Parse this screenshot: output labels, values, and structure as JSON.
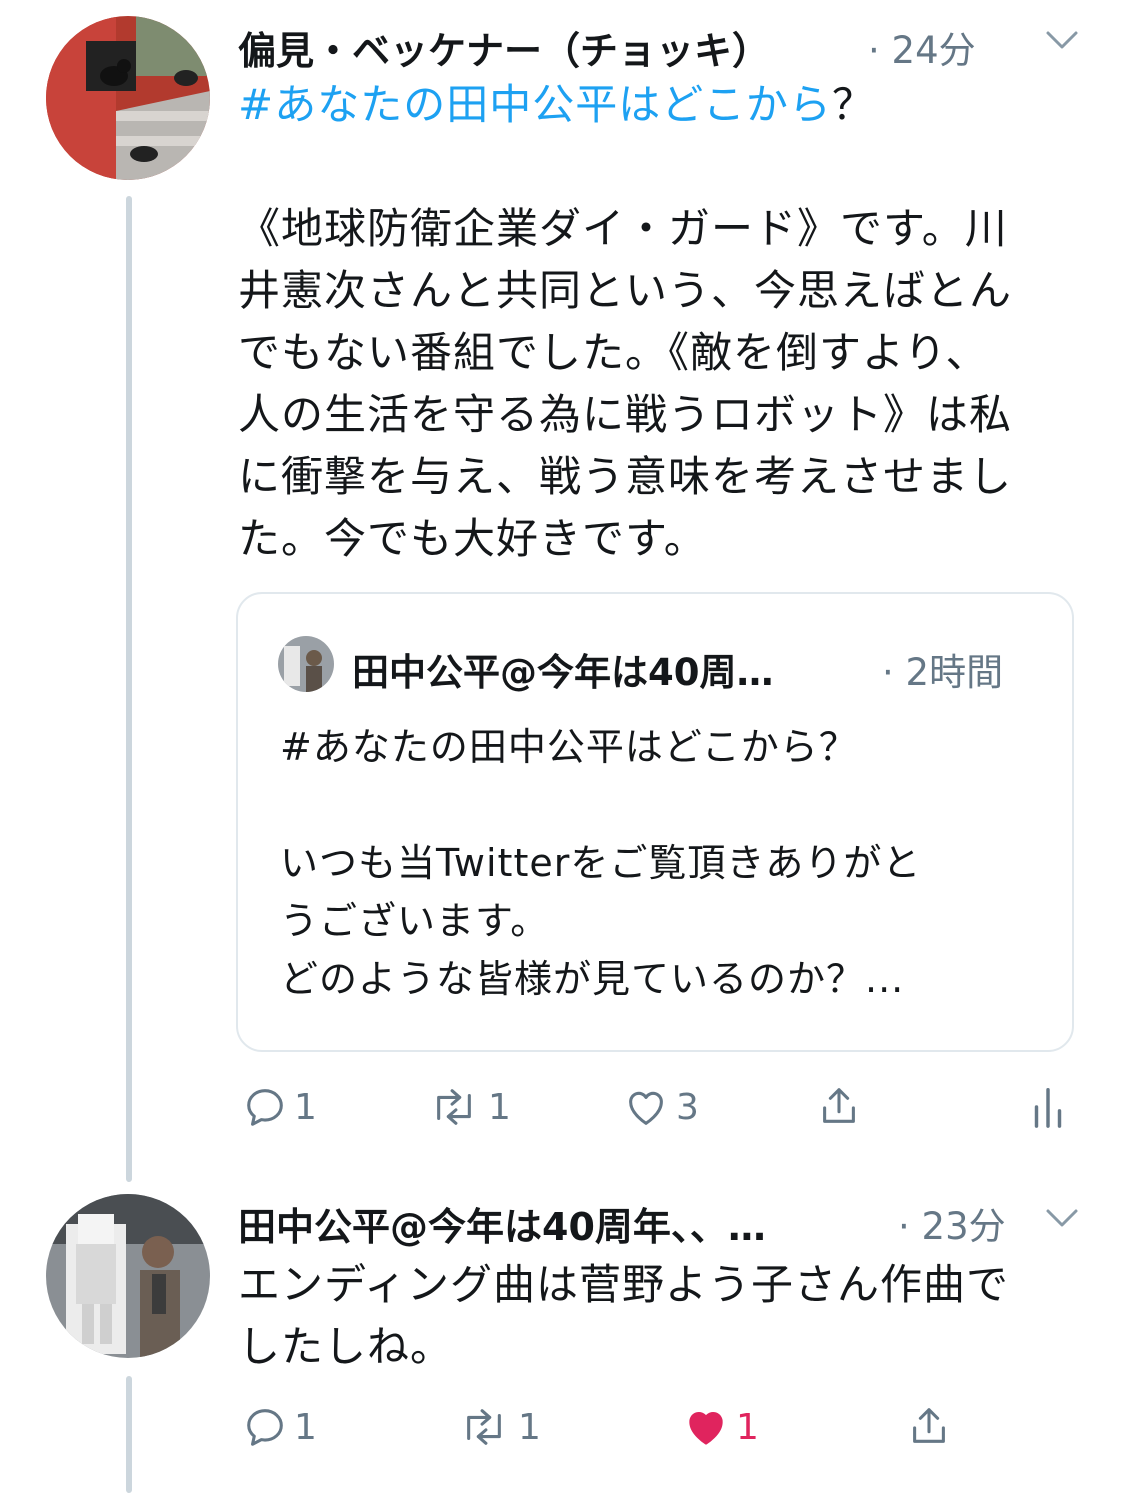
{
  "tweet1": {
    "author_name": "偏見・ベッケナー（チョッキ）",
    "time": "· 24分",
    "hashtag": "#あなたの田中公平はどこから",
    "hashtag_suffix": "？",
    "lines": [
      "《地球防衛企業ダイ・ガード》です。川",
      "井憲次さんと共同という、今思えばとん",
      "でもない番組でした。《敵を倒すより、",
      "人の生活を守る為に戦うロボット》は私",
      "に衝撃を与え、戦う意味を考えさせまし",
      "た。今でも大好きです。"
    ],
    "quote": {
      "author_name": "田中公平@今年は40周…",
      "time": "· 2時間",
      "lines": [
        "#あなたの田中公平はどこから？",
        "",
        "いつも当Twitterをご覧頂きありがと",
        "うございます。",
        "どのような皆様が見ているのか？..."
      ]
    },
    "actions": {
      "reply_count": "1",
      "retweet_count": "1",
      "like_count": "3"
    }
  },
  "tweet2": {
    "author_name": "田中公平@今年は40周年、、…",
    "time": "· 23分",
    "lines": [
      "エンディング曲は菅野よう子さん作曲で",
      "したしね。"
    ],
    "actions": {
      "reply_count": "1",
      "retweet_count": "1",
      "like_count": "1",
      "liked": true
    }
  },
  "colors": {
    "accent": "#1da1f2",
    "muted": "#657786",
    "like_active": "#e0245e",
    "border": "#e1e8ed",
    "thread_line": "#ccd6dd"
  },
  "icons": [
    "chevron-down-icon",
    "reply-icon",
    "retweet-icon",
    "like-icon",
    "share-icon",
    "analytics-icon"
  ]
}
